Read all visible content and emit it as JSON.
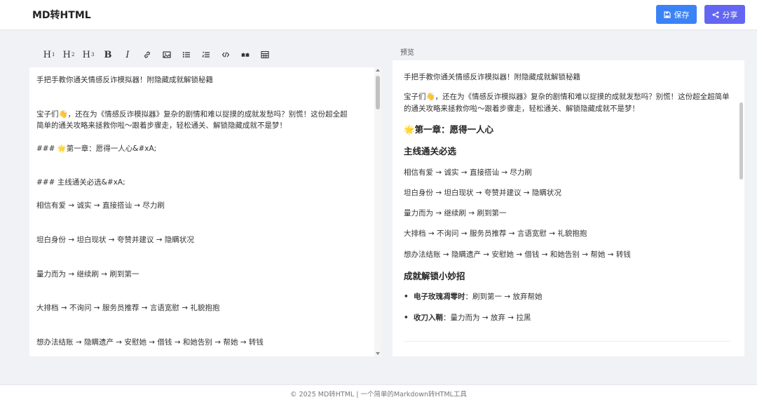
{
  "app": {
    "brand": "MD转HTML"
  },
  "header": {
    "save_label": "保存",
    "share_label": "分享",
    "save_color": "#3b82f6",
    "share_color": "#6366f1"
  },
  "toolbar": {
    "h1": "H",
    "h1_sup": "1",
    "h2": "H",
    "h2_sup": "2",
    "h3": "H",
    "h3_sup": "3",
    "bold": "B",
    "italic": "I",
    "icons": [
      "link-icon",
      "image-icon",
      "bullet-list-icon",
      "numbered-list-icon",
      "code-icon",
      "quote-icon",
      "table-icon"
    ]
  },
  "editor": {
    "lines": [
      "手把手教你通关情感反诈模拟器！附隐藏成就解锁秘籍",
      "",
      "",
      "宝子们👋，还在为《情感反诈模拟器》复杂的剧情和难以捉摸的成就发愁吗？别慌！这份超全超",
      "简单的通关攻略来拯救你啦～跟着步骤走，轻松通关、解锁隐藏成就不是梦！",
      "",
      "### 🌟第一章：愿得一人心&#xA;",
      "",
      "",
      "### 主线通关必选&#xA;",
      "",
      "相信有爱 → 诚实 → 直接搭讪 → 尽力刷",
      "",
      "",
      "坦白身份 → 坦白现状 → 夸赞并建议 → 隐瞒状况",
      "",
      "",
      "量力而为 → 继续刷 → 刷到第一",
      "",
      "",
      "大排档 → 不询问 → 服务员推荐 → 言语宽慰 → 礼貌抱抱",
      "",
      "",
      "想办法结账 → 隐瞒遗产 → 安慰她 → 借钱 → 和她告别 → 帮她 → 转钱"
    ]
  },
  "preview": {
    "label": "预览",
    "title": "手把手教你通关情感反诈模拟器！附隐藏成就解锁秘籍",
    "intro": "宝子们👋，还在为《情感反诈模拟器》复杂的剧情和难以捉摸的成就发愁吗？别慌！这份超全超简单的通关攻略来拯救你啦～跟着步骤走，轻松通关、解锁隐藏成就不是梦！",
    "chapter1": "🌟第一章：愿得一人心",
    "main_title": "主线通关必选",
    "steps": [
      "相信有爱 → 诚实 → 直接搭讪 → 尽力刷",
      "坦白身份 → 坦白现状 → 夸赞并建议 → 隐瞒状况",
      "量力而为 → 继续刷 → 刷到第一",
      "大排档 → 不询问 → 服务员推荐 → 言语宽慰 → 礼貌抱抱",
      "想办法结账 → 隐瞒遗产 → 安慰她 → 借钱 → 和她告别 → 帮她 → 转钱"
    ],
    "achievements_title": "成就解锁小妙招",
    "achievements": [
      {
        "name": "电子玫瑰凋零时",
        "desc": "：刷到第一 → 放弃帮她"
      },
      {
        "name": "收刀入鞘",
        "desc": "：量力而为 → 放弃 → 拉黑"
      }
    ]
  },
  "footer": {
    "text": "© 2025 MD转HTML | 一个简单的Markdown转HTML工具"
  }
}
